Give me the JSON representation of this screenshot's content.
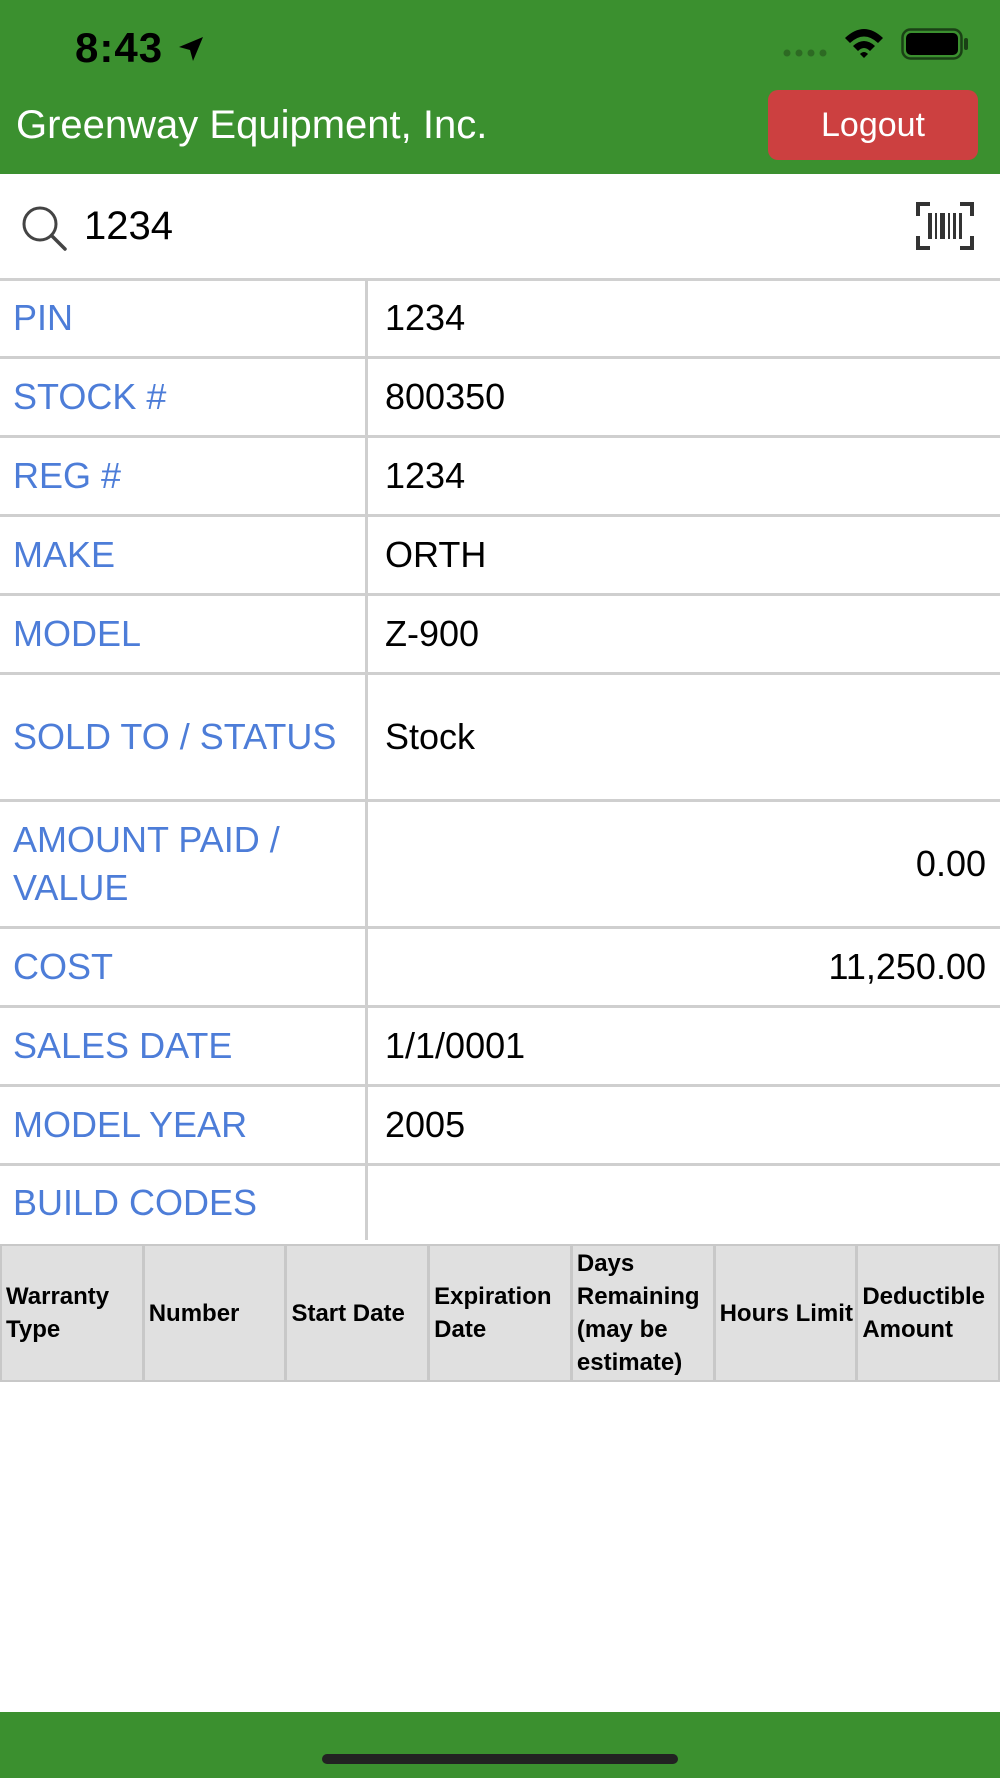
{
  "status_bar": {
    "time": "8:43"
  },
  "header": {
    "title": "Greenway Equipment, Inc.",
    "logout_label": "Logout"
  },
  "search": {
    "value": "1234"
  },
  "details": [
    {
      "label": "PIN",
      "value": "1234"
    },
    {
      "label": "STOCK #",
      "value": "800350"
    },
    {
      "label": "REG #",
      "value": "1234"
    },
    {
      "label": "MAKE",
      "value": "ORTH"
    },
    {
      "label": "MODEL",
      "value": "Z-900"
    },
    {
      "label": "SOLD TO / STATUS",
      "value": "Stock"
    },
    {
      "label": "AMOUNT PAID / VALUE",
      "value": "0.00"
    },
    {
      "label": "COST",
      "value": "11,250.00"
    },
    {
      "label": "SALES DATE",
      "value": "1/1/0001"
    },
    {
      "label": "MODEL YEAR",
      "value": "2005"
    },
    {
      "label": "BUILD CODES",
      "value": ""
    }
  ],
  "warranty": {
    "columns": [
      "Warranty Type",
      "Number",
      "Start Date",
      "Expiration Date",
      "Days Remaining (may be estimate)",
      "Hours Limit",
      "Deductible Amount"
    ]
  },
  "colors": {
    "header_green": "#3b902f",
    "logout_red": "#cc4040",
    "label_blue": "#4d7dd8"
  }
}
